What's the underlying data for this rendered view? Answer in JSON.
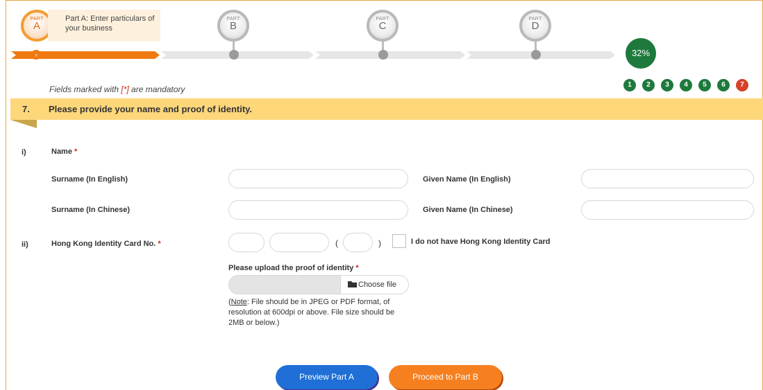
{
  "progress": {
    "parts": [
      {
        "small": "PART",
        "letter": "A"
      },
      {
        "small": "PART",
        "letter": "B"
      },
      {
        "small": "PART",
        "letter": "C"
      },
      {
        "small": "PART",
        "letter": "D"
      }
    ],
    "active_description": "Part A: Enter particulars of your business",
    "percent_label": "32%",
    "completion_fraction": 0.32,
    "steps": [
      "1",
      "2",
      "3",
      "4",
      "5",
      "6",
      "7"
    ],
    "current_step": "7",
    "arrow_glyph": "›"
  },
  "mandatory_note": {
    "prefix": "Fields marked with ",
    "marker": "[*]",
    "suffix": " are mandatory"
  },
  "section": {
    "number": "7.",
    "title": "Please provide your name and proof of identity."
  },
  "name_block": {
    "roman": "i)",
    "label": "Name",
    "required_marker": "*",
    "surname_en": "Surname (In English)",
    "given_en": "Given Name (In English)",
    "surname_zh": "Surname (In Chinese)",
    "given_zh": "Given Name (In Chinese)"
  },
  "hkid_block": {
    "roman": "ii)",
    "label": "Hong Kong Identity Card No.",
    "required_marker": "*",
    "open_paren": "(",
    "close_paren": ")",
    "no_card_label": "I do not have Hong Kong Identity Card"
  },
  "upload": {
    "label": "Please upload the proof of identity",
    "required_marker": "*",
    "button_label": "Choose file",
    "icon": "folder-icon",
    "note_lead": "(",
    "note_keyword": "Note",
    "note_text": ": File should be in JPEG or PDF format, of resolution at 600dpi or above. File size should be 2MB or below.)"
  },
  "actions": {
    "preview": "Preview Part A",
    "proceed": "Proceed to Part B"
  },
  "colors": {
    "accent_orange": "#f07a12",
    "progress_green": "#1e7a3c",
    "current_step_red": "#d5422a",
    "banner_yellow": "#fdd77a",
    "primary_blue": "#1f6fd6"
  }
}
